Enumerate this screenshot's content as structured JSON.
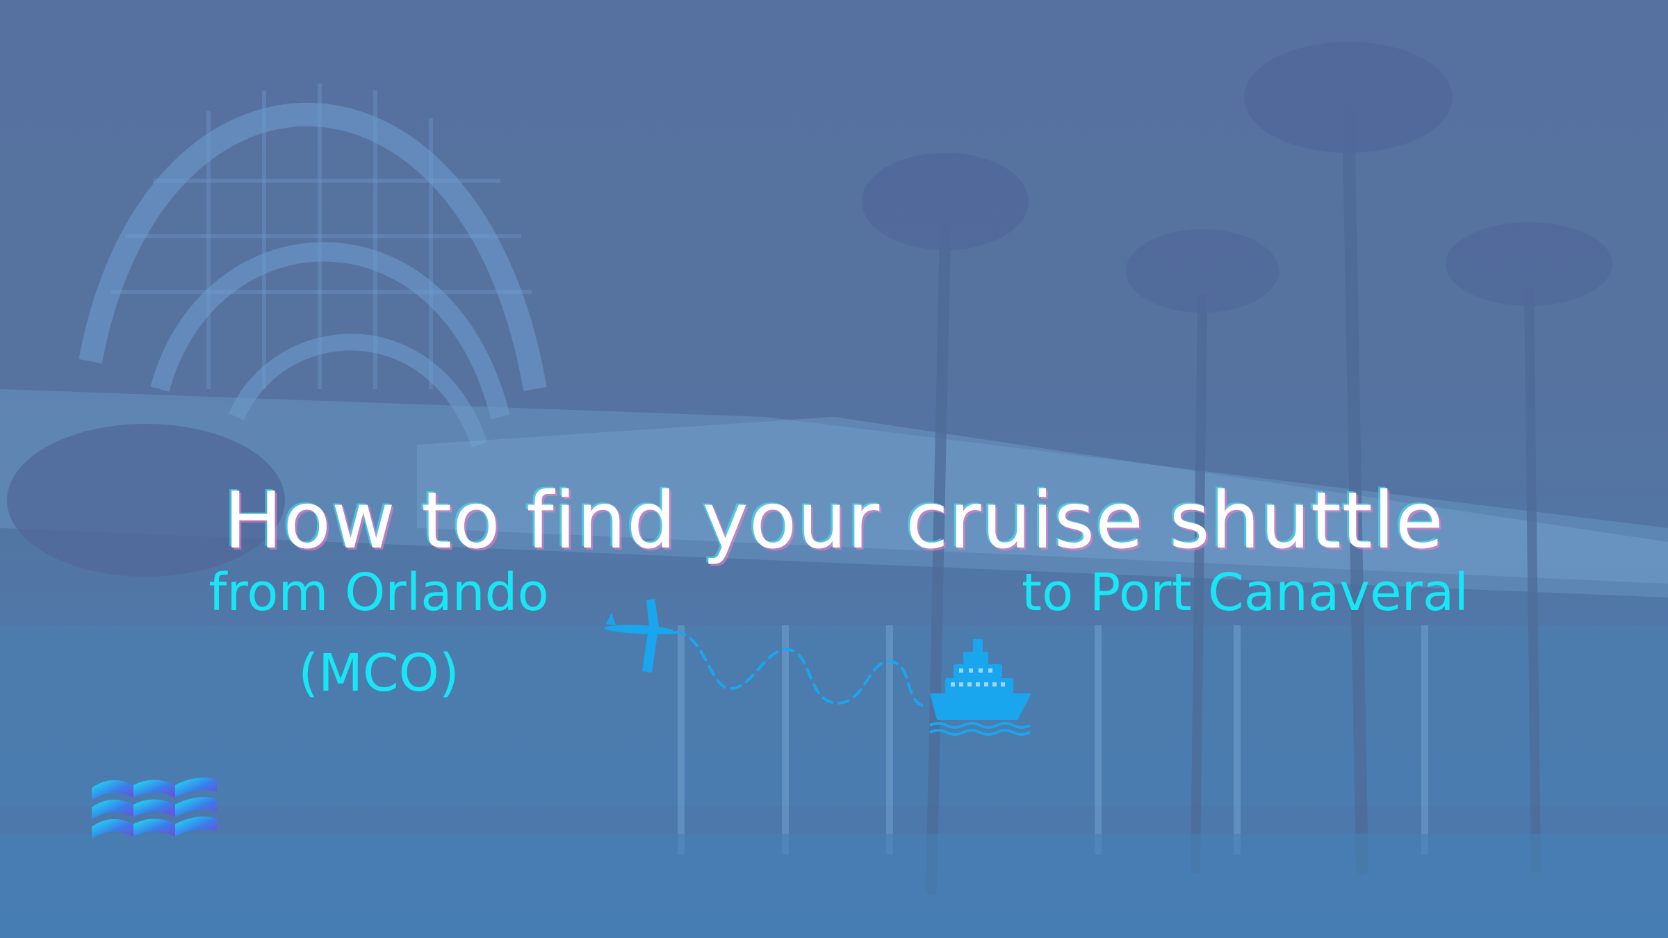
{
  "title": "How to find your cruise shuttle",
  "origin": {
    "line1": "from Orlando",
    "line2": "(MCO)"
  },
  "destination": {
    "label": "to Port Canaveral"
  },
  "icons": {
    "plane": "airplane-icon",
    "route": "dashed-route-line",
    "ship": "cruise-ship-icon",
    "logo": "wave-logo-icon"
  },
  "colors": {
    "overlay": "#56729f",
    "accent": "#19e6f5",
    "icon_blue": "#1aa6ee",
    "title": "#ffffff"
  }
}
